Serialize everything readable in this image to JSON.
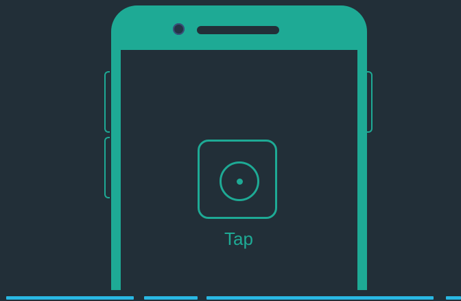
{
  "screen": {
    "action_label": "Tap",
    "action_icon": "tap-target-icon"
  },
  "colors": {
    "background": "#222f38",
    "accent": "#1eaa95",
    "progress": "#29b8e3"
  },
  "progress": {
    "segment_count": 4
  }
}
